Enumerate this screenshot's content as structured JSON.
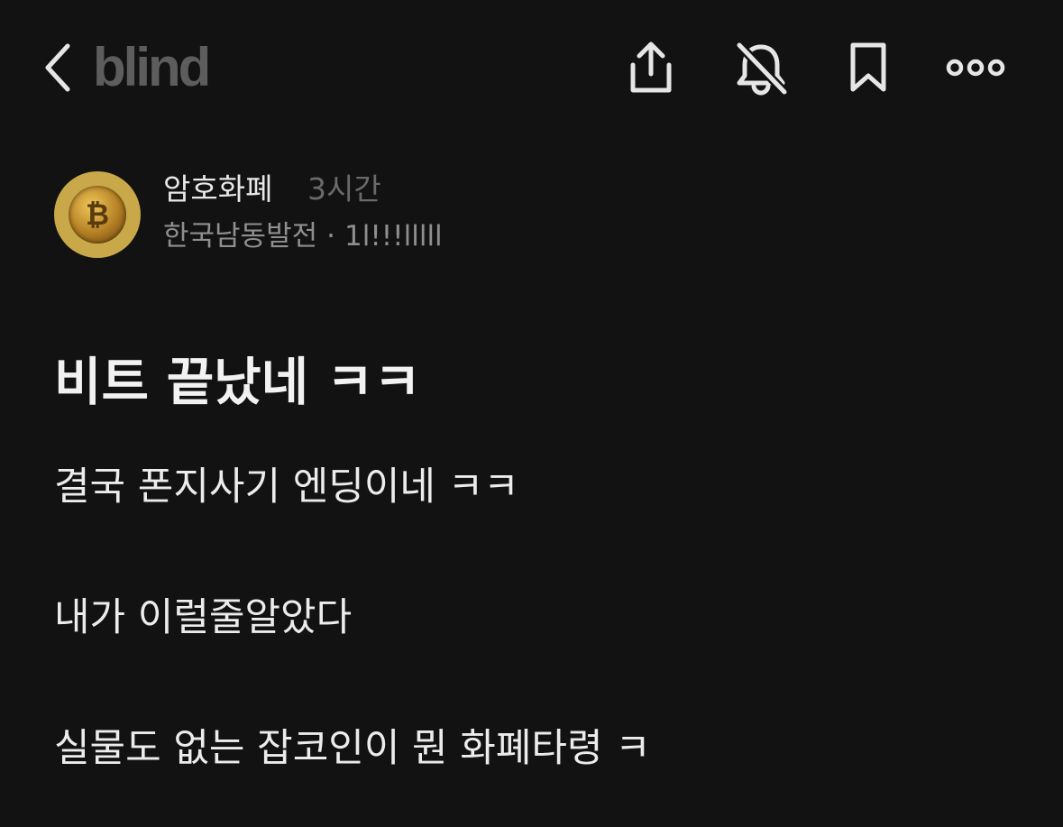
{
  "header": {
    "logo_text": "blind",
    "icons": {
      "back": "chevron-left-icon",
      "share": "share-icon",
      "mute": "bell-off-icon",
      "bookmark": "bookmark-icon",
      "more": "more-horizontal-icon"
    }
  },
  "author": {
    "channel": "암호화폐",
    "time": "3시간",
    "company": "한국남동발전",
    "separator": "·",
    "nickname": "1l!!!lllll",
    "avatar": "bitcoin-avatar"
  },
  "post": {
    "title": "비트 끝났네 ㅋㅋ",
    "body": [
      "결국 폰지사기 엔딩이네 ㅋㅋ",
      "내가 이럴줄알았다",
      "실물도 없는 잡코인이 뭔 화폐타령 ㅋ"
    ]
  },
  "colors": {
    "background": "#121212",
    "text": "#ececec",
    "muted": "#8f8f8f",
    "logo": "#5d5d5d",
    "avatar_bg": "#c9a84a"
  }
}
